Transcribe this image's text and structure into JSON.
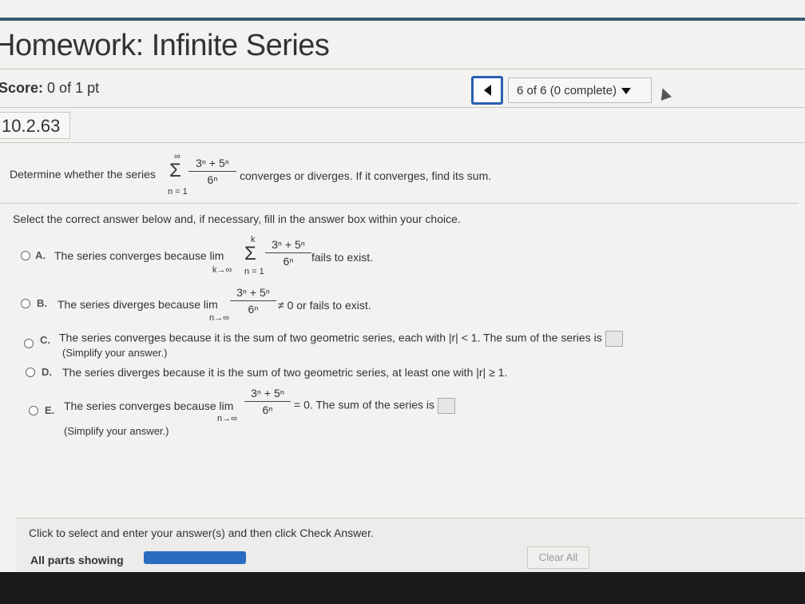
{
  "header": {
    "title": "Homework: Infinite Series",
    "score_label": "Score:",
    "score_value": "0 of 1 pt",
    "question_nav": "6 of 6 (0 complete)",
    "question_id": "10.2.63"
  },
  "question": {
    "prefix": "Determine whether the series",
    "suffix": "converges or diverges. If it converges, find its sum.",
    "sum_upper": "∞",
    "sum_lower": "n = 1",
    "numerator": "3ⁿ + 5ⁿ",
    "denominator": "6ⁿ",
    "instruction": "Select the correct answer below and, if necessary, fill in the answer box within your choice."
  },
  "options": {
    "a": {
      "letter": "A.",
      "text": "The series converges because  lim",
      "lim_sub": "k→∞",
      "sum_upper": "k",
      "sum_lower": "n = 1",
      "tail": "fails to exist."
    },
    "b": {
      "letter": "B.",
      "text": "The series diverges because  lim",
      "lim_sub": "n→∞",
      "tail": "≠ 0 or fails to exist."
    },
    "c": {
      "letter": "C.",
      "text": "The series converges because it is the sum of two geometric series, each with |r| < 1. The sum of the series is",
      "sub": "(Simplify your answer.)"
    },
    "d": {
      "letter": "D.",
      "text": "The series diverges because it is the sum of two geometric series, at least one with |r| ≥ 1."
    },
    "e": {
      "letter": "E.",
      "text": "The series converges because  lim",
      "lim_sub": "n→∞",
      "tail": "= 0. The sum of the series is",
      "sub": "(Simplify your answer.)"
    }
  },
  "footer": {
    "hint": "Click to select and enter your answer(s) and then click Check Answer.",
    "parts": "All parts showing",
    "clear": "Clear All"
  }
}
